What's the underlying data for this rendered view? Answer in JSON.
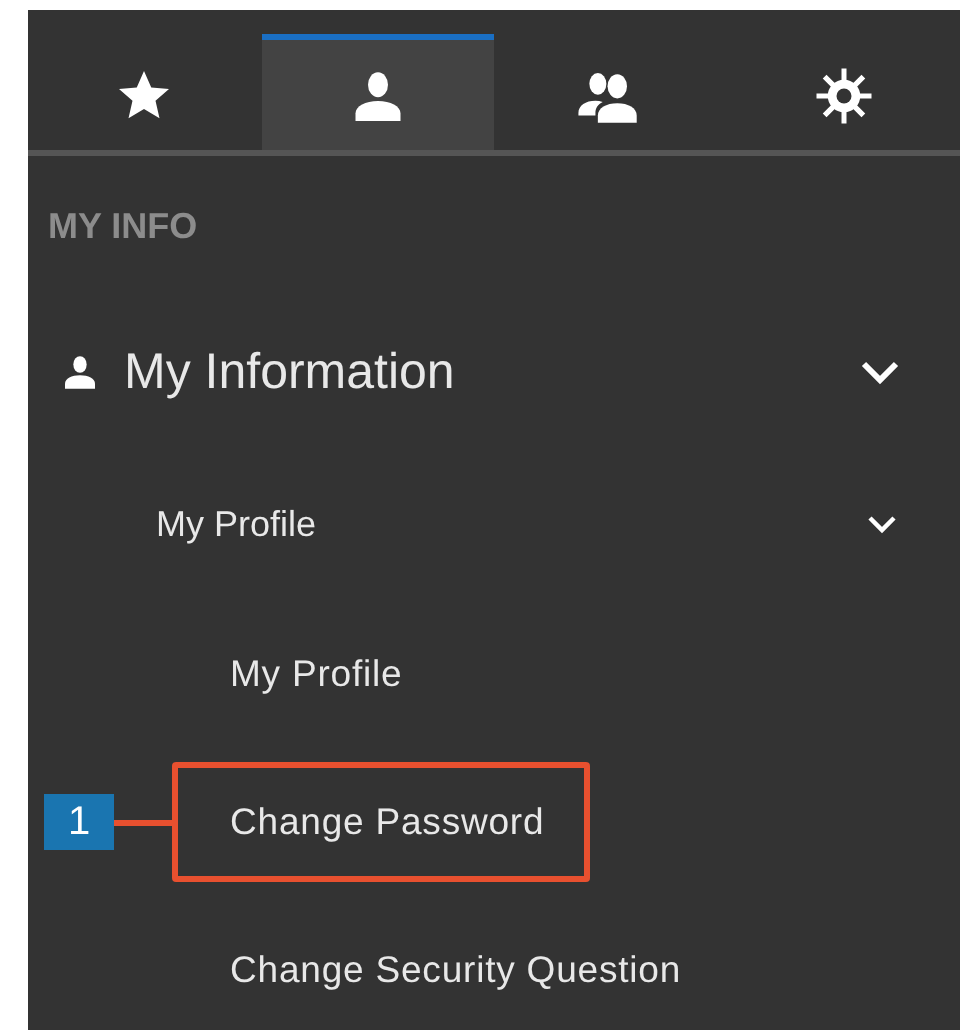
{
  "tabs": [
    {
      "kind": "star",
      "selected": false
    },
    {
      "kind": "user",
      "selected": true
    },
    {
      "kind": "users",
      "selected": false
    },
    {
      "kind": "gear",
      "selected": false
    }
  ],
  "section_title": "MY INFO",
  "menu": [
    {
      "label": "My Information",
      "kind": "user",
      "expanded": true,
      "children": [
        {
          "label": "My Profile",
          "expanded": true,
          "children": [
            {
              "label": "My Profile",
              "highlighted": false
            },
            {
              "label": "Change Password",
              "highlighted": true,
              "callout": "1"
            },
            {
              "label": "Change Security Question",
              "highlighted": false
            }
          ]
        }
      ]
    }
  ]
}
